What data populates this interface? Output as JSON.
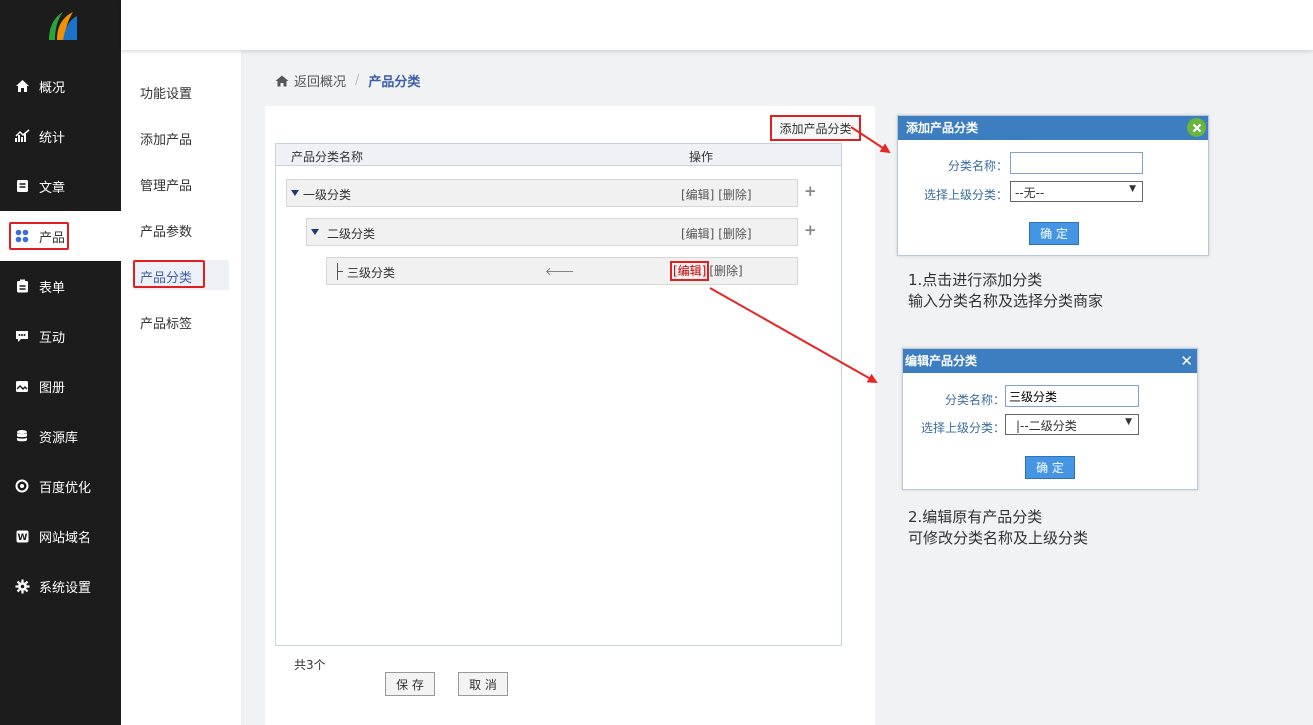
{
  "nav": {
    "items": [
      {
        "label": "概况",
        "icon": "home-icon"
      },
      {
        "label": "统计",
        "icon": "chart-icon"
      },
      {
        "label": "文章",
        "icon": "document-icon"
      },
      {
        "label": "产品",
        "icon": "grid-icon"
      },
      {
        "label": "表单",
        "icon": "clipboard-icon"
      },
      {
        "label": "互动",
        "icon": "chat-icon"
      },
      {
        "label": "图册",
        "icon": "album-icon"
      },
      {
        "label": "资源库",
        "icon": "database-icon"
      },
      {
        "label": "百度优化",
        "icon": "target-icon"
      },
      {
        "label": "网站域名",
        "icon": "w-icon"
      },
      {
        "label": "系统设置",
        "icon": "gear-icon"
      }
    ],
    "active": "产品"
  },
  "subnav": {
    "items": [
      "功能设置",
      "添加产品",
      "管理产品",
      "产品参数",
      "产品分类",
      "产品标签"
    ],
    "active": "产品分类"
  },
  "breadcrumb": {
    "back": "返回概况",
    "sep": "/",
    "current": "产品分类"
  },
  "panel": {
    "add_button": "添加产品分类",
    "col_name": "产品分类名称",
    "col_ops": "操作",
    "rows": [
      {
        "name": "一级分类",
        "edit": "[编辑]",
        "delete": "[删除]"
      },
      {
        "name": "二级分类",
        "edit": "[编辑]",
        "delete": "[删除]"
      },
      {
        "name": "三级分类",
        "edit": "[编辑]",
        "delete": "[删除]"
      }
    ],
    "count": "共3个",
    "save": "保 存",
    "cancel": "取 消"
  },
  "add_dialog": {
    "title": "添加产品分类",
    "name_label": "分类名称：",
    "name_value": "",
    "parent_label": "选择上级分类：",
    "parent_value": "--无--",
    "ok": "确 定"
  },
  "edit_dialog": {
    "title": "编辑产品分类",
    "name_label": "分类名称：",
    "name_value": "三级分类",
    "parent_label": "选择上级分类：",
    "parent_value": "|--二级分类",
    "ok": "确 定"
  },
  "notes": {
    "note1_line1": "1.点击进行添加分类",
    "note1_line2": "输入分类名称及选择分类商家",
    "note2_line1": "2.编辑原有产品分类",
    "note2_line2": "可修改分类名称及上级分类"
  },
  "colors": {
    "sidebar": "#1c1c1c",
    "accent": "#3d7ec0",
    "highlight": "#e02020",
    "ok": "#4495e3"
  }
}
